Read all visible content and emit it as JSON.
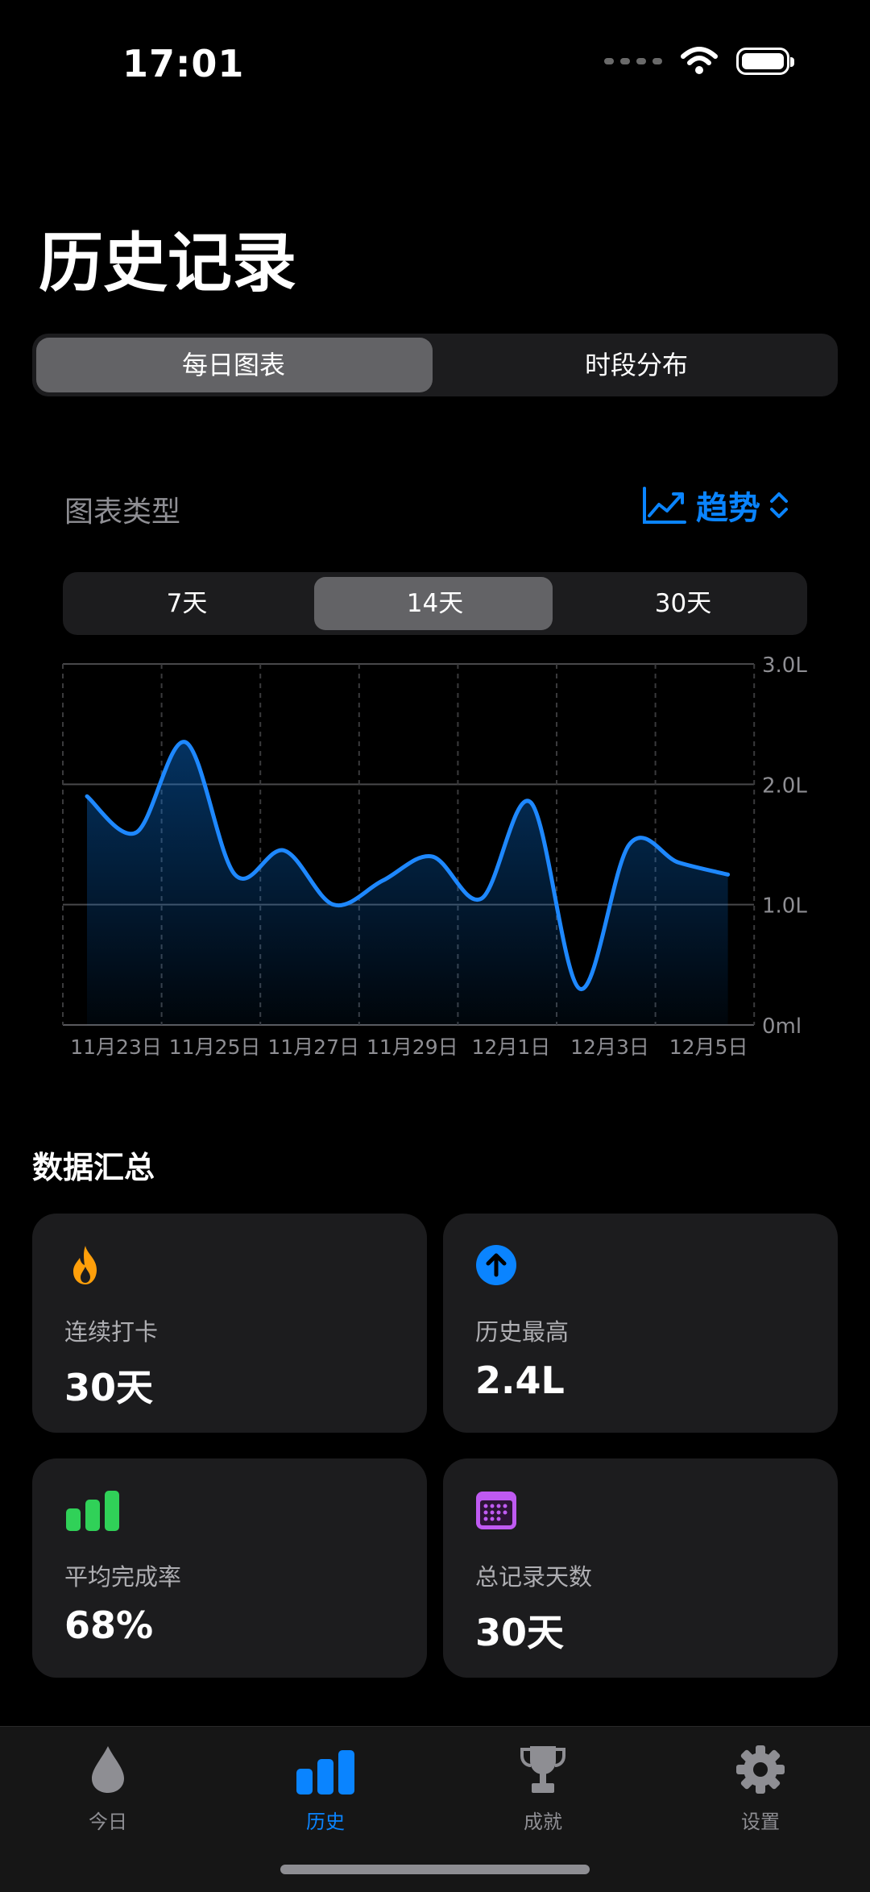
{
  "status": {
    "time": "17:01"
  },
  "page": {
    "title": "历史记录"
  },
  "view_tabs": [
    {
      "label": "每日图表",
      "selected": true
    },
    {
      "label": "时段分布",
      "selected": false
    }
  ],
  "chart_type": {
    "label": "图表类型",
    "value": "趋势"
  },
  "range_tabs": [
    {
      "label": "7天",
      "selected": false
    },
    {
      "label": "14天",
      "selected": true
    },
    {
      "label": "30天",
      "selected": false
    }
  ],
  "chart_data": {
    "type": "area",
    "x": [
      "11月22日",
      "11月23日",
      "11月24日",
      "11月25日",
      "11月26日",
      "11月27日",
      "11月28日",
      "11月29日",
      "11月30日",
      "12月1日",
      "12月2日",
      "12月3日",
      "12月4日",
      "12月5日"
    ],
    "tick_labels": [
      "11月23日",
      "11月25日",
      "11月27日",
      "11月29日",
      "12月1日",
      "12月3日",
      "12月5日"
    ],
    "values": [
      1.9,
      1.6,
      2.35,
      1.25,
      1.45,
      1.0,
      1.2,
      1.4,
      1.05,
      1.85,
      0.3,
      1.5,
      1.35,
      1.25
    ],
    "ylim": [
      0,
      3.0
    ],
    "y_ticks": [
      {
        "v": 0,
        "label": "0ml"
      },
      {
        "v": 1,
        "label": "1.0L"
      },
      {
        "v": 2,
        "label": "2.0L"
      },
      {
        "v": 3,
        "label": "3.0L"
      }
    ],
    "grid": true,
    "line_color": "#1e88ff"
  },
  "summary": {
    "title": "数据汇总",
    "cards": [
      {
        "icon": "flame-icon",
        "label": "连续打卡",
        "value": "30天",
        "color": "#ff9f0a"
      },
      {
        "icon": "arrow-up-circle-icon",
        "label": "历史最高",
        "value": "2.4L",
        "color": "#0a84ff"
      },
      {
        "icon": "bar-chart-icon",
        "label": "平均完成率",
        "value": "68%",
        "color": "#30d158"
      },
      {
        "icon": "calendar-icon",
        "label": "总记录天数",
        "value": "30天",
        "color": "#bf5af2"
      }
    ]
  },
  "tabbar": [
    {
      "icon": "drop-icon",
      "label": "今日",
      "active": false
    },
    {
      "icon": "chart-bars-icon",
      "label": "历史",
      "active": true
    },
    {
      "icon": "trophy-icon",
      "label": "成就",
      "active": false
    },
    {
      "icon": "gear-icon",
      "label": "设置",
      "active": false
    }
  ]
}
